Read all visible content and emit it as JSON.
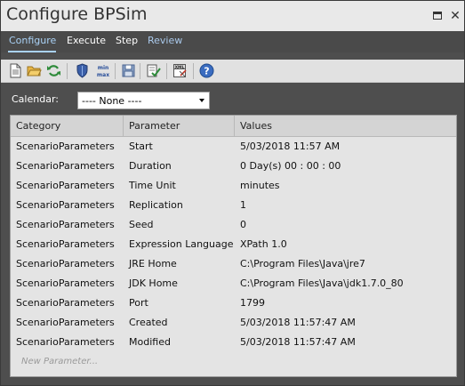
{
  "window": {
    "title": "Configure BPSim",
    "restore_icon": "restore-icon",
    "close_glyph": "✕"
  },
  "tabs": [
    {
      "label": "Configure",
      "state": "active"
    },
    {
      "label": "Execute",
      "state": "normal"
    },
    {
      "label": "Step",
      "state": "normal"
    },
    {
      "label": "Review",
      "state": "dim"
    }
  ],
  "toolbar": {
    "icons": [
      "new-document-icon",
      "open-folder-icon",
      "refresh-icon",
      "shield-icon",
      "min-max-icon",
      "save-icon",
      "validate-icon",
      "xml-export-icon",
      "help-icon"
    ],
    "minmax_text": "min\nmax",
    "xml_text": "XML"
  },
  "calendar": {
    "label": "Calendar:",
    "selected": "---- None ----"
  },
  "grid": {
    "columns": [
      "Category",
      "Parameter",
      "Values"
    ],
    "rows": [
      [
        "ScenarioParameters",
        "Start",
        "5/03/2018 11:57 AM"
      ],
      [
        "ScenarioParameters",
        "Duration",
        "0 Day(s) 00 : 00 : 00"
      ],
      [
        "ScenarioParameters",
        "Time Unit",
        "minutes"
      ],
      [
        "ScenarioParameters",
        "Replication",
        "1"
      ],
      [
        "ScenarioParameters",
        "Seed",
        "0"
      ],
      [
        "ScenarioParameters",
        "Expression Language",
        "XPath 1.0"
      ],
      [
        "ScenarioParameters",
        "JRE Home",
        "C:\\Program Files\\Java\\jre7"
      ],
      [
        "ScenarioParameters",
        "JDK Home",
        "C:\\Program Files\\Java\\jdk1.7.0_80"
      ],
      [
        "ScenarioParameters",
        "Port",
        "1799"
      ],
      [
        "ScenarioParameters",
        "Created",
        "5/03/2018 11:57:47 AM"
      ],
      [
        "ScenarioParameters",
        "Modified",
        "5/03/2018 11:57:47 AM"
      ]
    ],
    "new_row_placeholder": "New Parameter..."
  },
  "colors": {
    "accent_tab": "#a9d1f5",
    "panel_bg": "#4e4e4e",
    "grid_bg": "#e4e4e4"
  }
}
